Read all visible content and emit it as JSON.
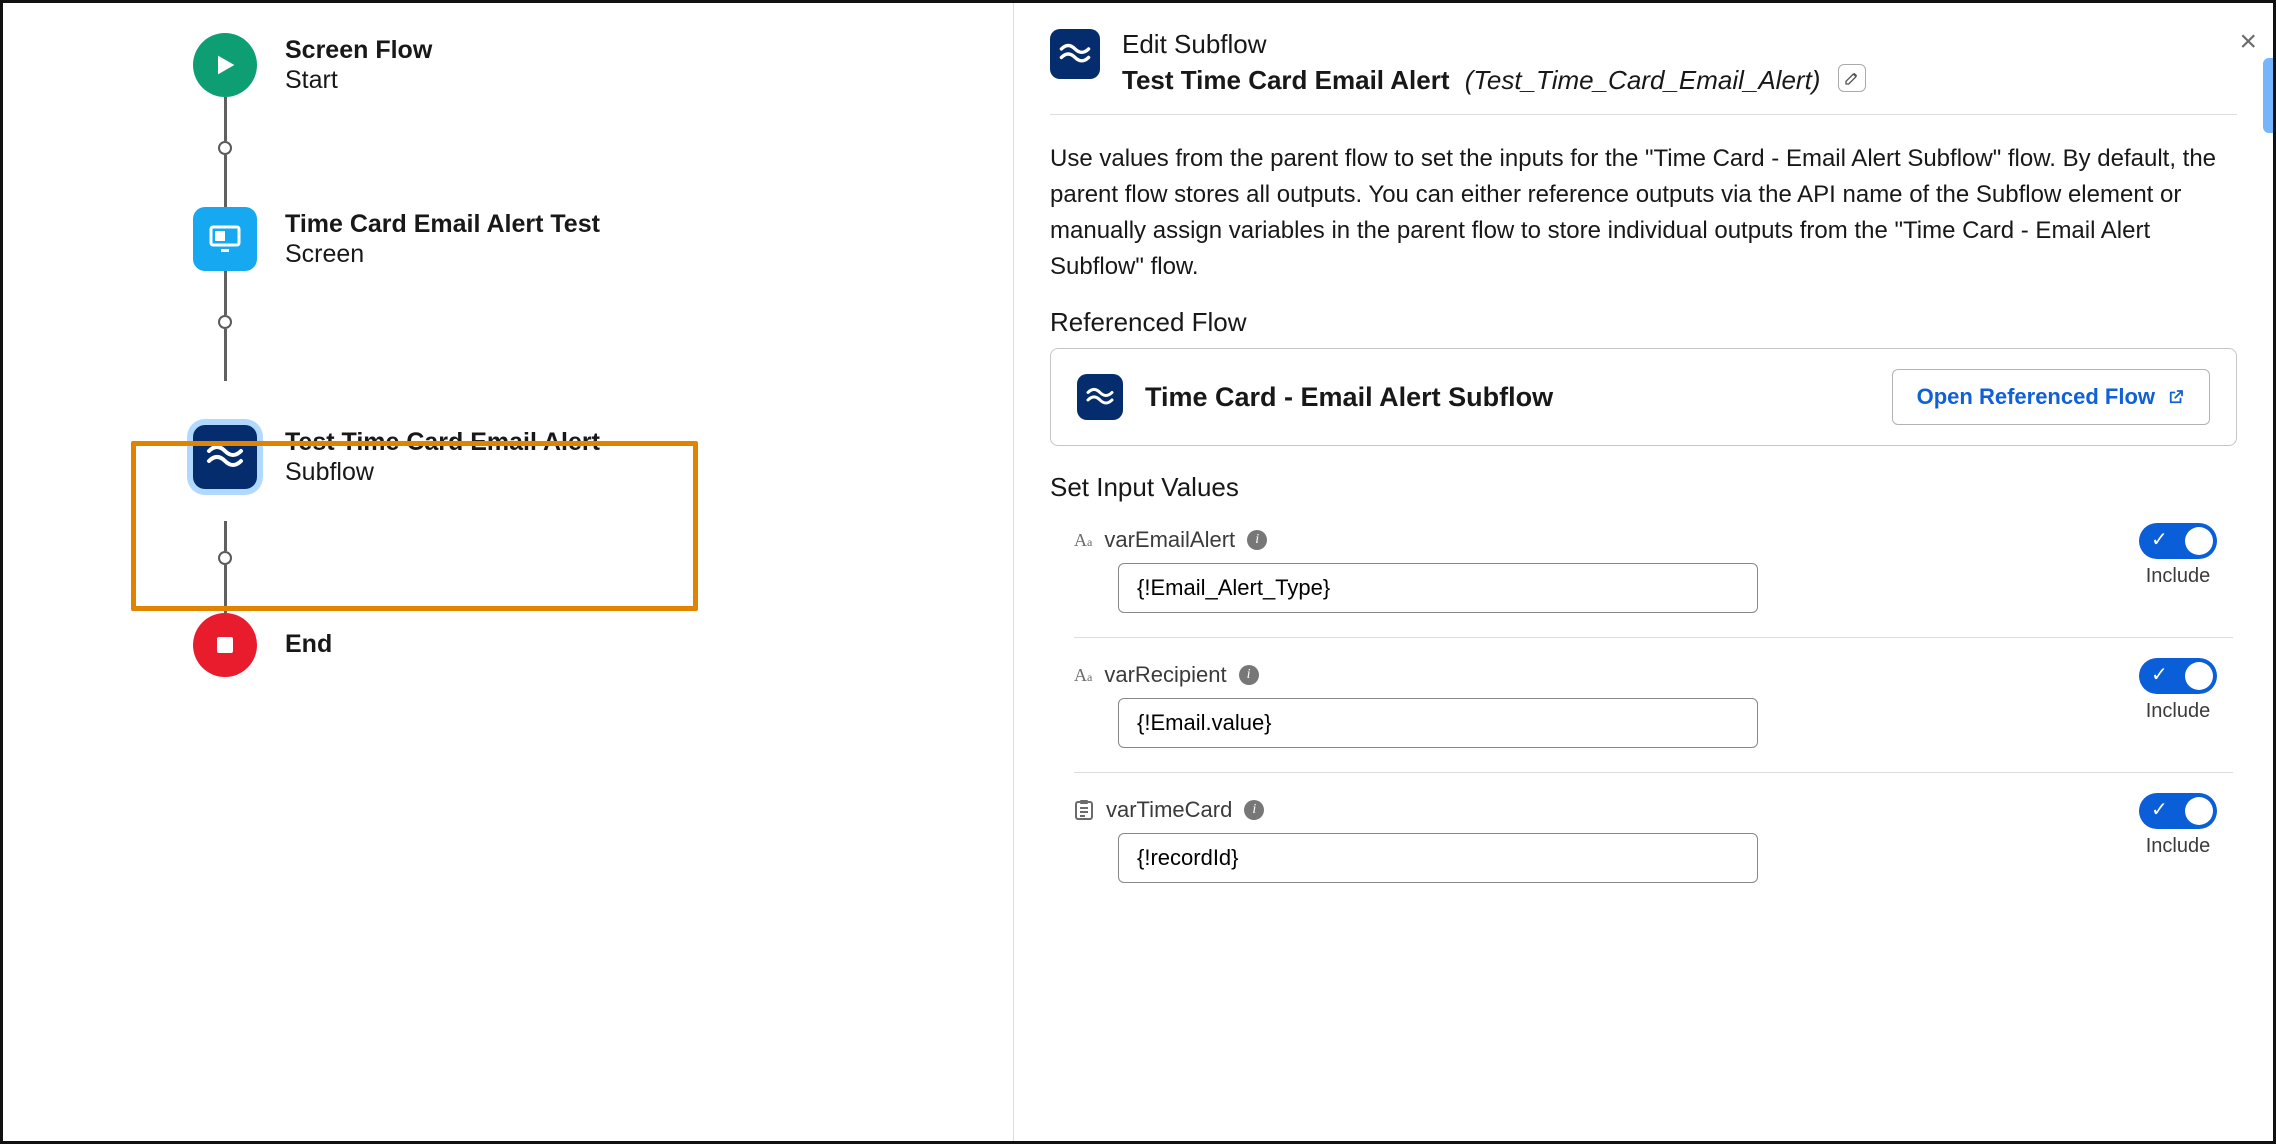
{
  "flow": {
    "start": {
      "title": "Screen Flow",
      "subtitle": "Start"
    },
    "screen": {
      "title": "Time Card Email Alert Test",
      "subtitle": "Screen"
    },
    "subflow": {
      "title": "Test Time Card Email Alert",
      "subtitle": "Subflow"
    },
    "end": {
      "title": "End"
    }
  },
  "panel": {
    "heading1": "Edit Subflow",
    "heading2_name": "Test Time Card Email Alert",
    "heading2_api": "(Test_Time_Card_Email_Alert)",
    "description": "Use values from the parent flow to set the inputs for the \"Time Card - Email Alert Subflow\" flow. By default, the parent flow stores all outputs. You can either reference outputs via the API name of the Subflow element or manually assign variables in the parent flow to store individual outputs from the \"Time Card - Email Alert Subflow\" flow.",
    "referenced_label": "Referenced Flow",
    "referenced_name": "Time Card - Email Alert Subflow",
    "open_referenced": "Open Referenced Flow",
    "inputs_label": "Set Input Values",
    "include_label": "Include",
    "inputs": [
      {
        "icon": "text",
        "name": "varEmailAlert",
        "value": "{!Email_Alert_Type}"
      },
      {
        "icon": "text",
        "name": "varRecipient",
        "value": "{!Email.value}"
      },
      {
        "icon": "record",
        "name": "varTimeCard",
        "value": "{!recordId}"
      }
    ]
  }
}
